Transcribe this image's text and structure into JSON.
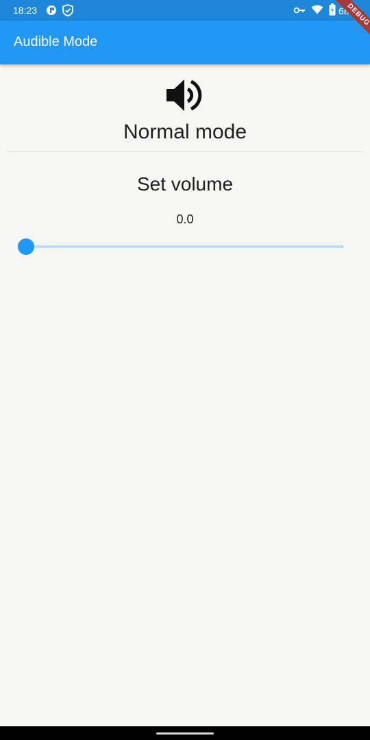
{
  "status_bar": {
    "time": "18:23",
    "battery": "68%",
    "left_icons": [
      "app-notification-icon",
      "shield-check-icon"
    ],
    "right_icons": [
      "vpn-key-icon",
      "wifi-icon",
      "battery-icon"
    ]
  },
  "app_bar": {
    "title": "Audible Mode",
    "color": "#2196f3"
  },
  "debug_banner": "DEBUG",
  "main": {
    "mode_icon": "speaker-volume-icon",
    "mode_label": "Normal mode",
    "volume_title": "Set volume",
    "volume_value": "0.0",
    "slider": {
      "value": 0.0,
      "min": 0.0,
      "max": 1.0,
      "active_color": "#2196f3",
      "inactive_color": "#bcdcf7"
    }
  }
}
